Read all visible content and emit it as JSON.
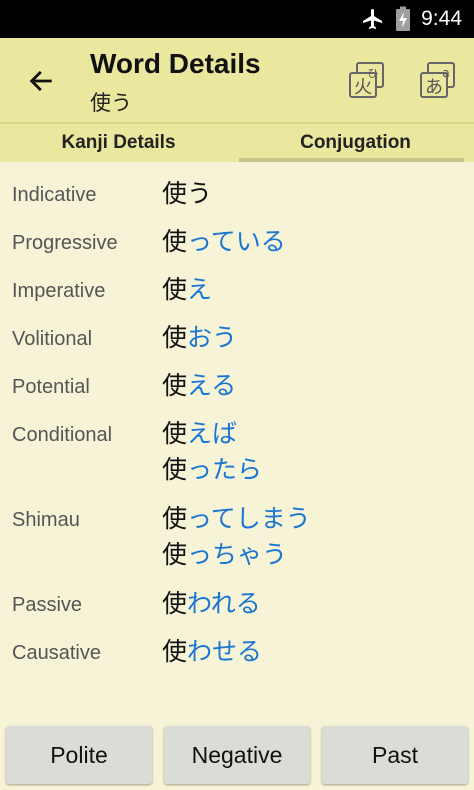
{
  "status_bar": {
    "time": "9:44",
    "icons": [
      "airplane-icon",
      "battery-charging-icon"
    ]
  },
  "app_bar": {
    "title": "Word Details",
    "subtitle": "使う",
    "back_icon": "arrow-left-icon",
    "actions": [
      {
        "name": "kanji-dictionary-icon",
        "glyph_main": "火",
        "glyph_small": "ひ"
      },
      {
        "name": "kana-dictionary-icon",
        "glyph_main": "あ",
        "glyph_small": "a"
      }
    ]
  },
  "tabs": [
    {
      "label": "Kanji Details",
      "selected": false
    },
    {
      "label": "Conjugation",
      "selected": true
    }
  ],
  "conjugations": [
    {
      "label": "Indicative",
      "forms": [
        {
          "stem": "使う",
          "ending": ""
        }
      ]
    },
    {
      "label": "Progressive",
      "forms": [
        {
          "stem": "使",
          "ending": "っている"
        }
      ]
    },
    {
      "label": "Imperative",
      "forms": [
        {
          "stem": "使",
          "ending": "え"
        }
      ]
    },
    {
      "label": "Volitional",
      "forms": [
        {
          "stem": "使",
          "ending": "おう"
        }
      ]
    },
    {
      "label": "Potential",
      "forms": [
        {
          "stem": "使",
          "ending": "える"
        }
      ]
    },
    {
      "label": "Conditional",
      "forms": [
        {
          "stem": "使",
          "ending": "えば"
        },
        {
          "stem": "使",
          "ending": "ったら"
        }
      ]
    },
    {
      "label": "Shimau",
      "forms": [
        {
          "stem": "使",
          "ending": "ってしまう"
        },
        {
          "stem": "使",
          "ending": "っちゃう"
        }
      ]
    },
    {
      "label": "Passive",
      "forms": [
        {
          "stem": "使",
          "ending": "われる"
        }
      ]
    },
    {
      "label": "Causative",
      "forms": [
        {
          "stem": "使",
          "ending": "わせる"
        }
      ]
    }
  ],
  "bottom_buttons": [
    "Polite",
    "Negative",
    "Past"
  ],
  "colors": {
    "app_bar": "#eae79e",
    "background": "#f6f3d6",
    "ending_text": "#1976d2"
  }
}
